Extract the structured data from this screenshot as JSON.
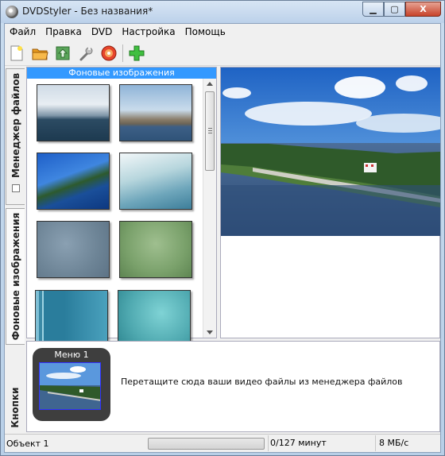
{
  "window": {
    "title": "DVDStyler - Без названия*",
    "controls": {
      "minimize": "▁",
      "maximize": "▢",
      "close": "X"
    }
  },
  "menubar": {
    "items": [
      "Файл",
      "Правка",
      "DVD",
      "Настройка",
      "Помощь"
    ]
  },
  "toolbar": {
    "buttons": [
      "new-icon",
      "open-icon",
      "save-icon",
      "settings-wrench-icon",
      "burn-disc-icon",
      "add-icon"
    ]
  },
  "tabs": {
    "file_manager": "Менеджер файлов",
    "backgrounds": "Фоновые изображения",
    "buttons": "Кнопки"
  },
  "background_panel": {
    "header": "Фоновые изображения"
  },
  "titleset": {
    "menu_label": "Меню 1",
    "drop_hint": "Перетащите сюда ваши видео файлы из менеджера файлов"
  },
  "statusbar": {
    "object": "Объект 1",
    "progress_fraction": 0,
    "minutes": "0/127 минут",
    "rate": "8 МБ/с"
  },
  "colors": {
    "panel_header_bg": "#3399ff",
    "menu_card_bg": "#3e3e3e",
    "close_button": "#c7432a"
  }
}
